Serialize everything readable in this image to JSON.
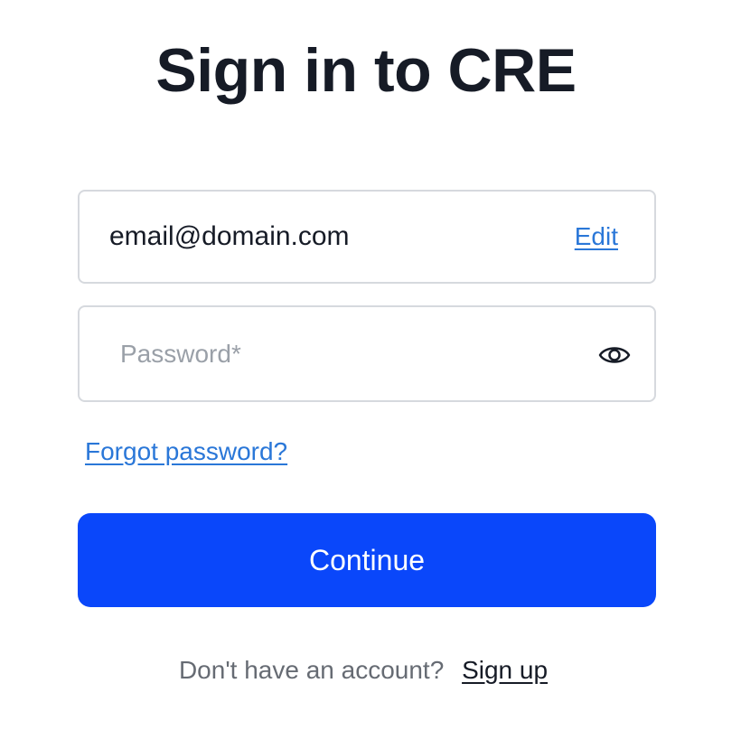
{
  "page": {
    "title": "Sign in to CRE"
  },
  "email": {
    "value": "email@domain.com",
    "edit_label": "Edit"
  },
  "password": {
    "placeholder": "Password*",
    "value": "",
    "toggle_icon": "eye-icon"
  },
  "links": {
    "forgot_password": "Forgot password?"
  },
  "actions": {
    "continue_label": "Continue"
  },
  "signup": {
    "prompt": "Don't have an account?",
    "link_label": "Sign up"
  },
  "colors": {
    "primary_button": "#0a47fa",
    "link": "#2a77d8",
    "title_text": "#161b26",
    "field_border": "#d6d9de",
    "placeholder": "#9aa0a8",
    "muted_text": "#666b73"
  }
}
